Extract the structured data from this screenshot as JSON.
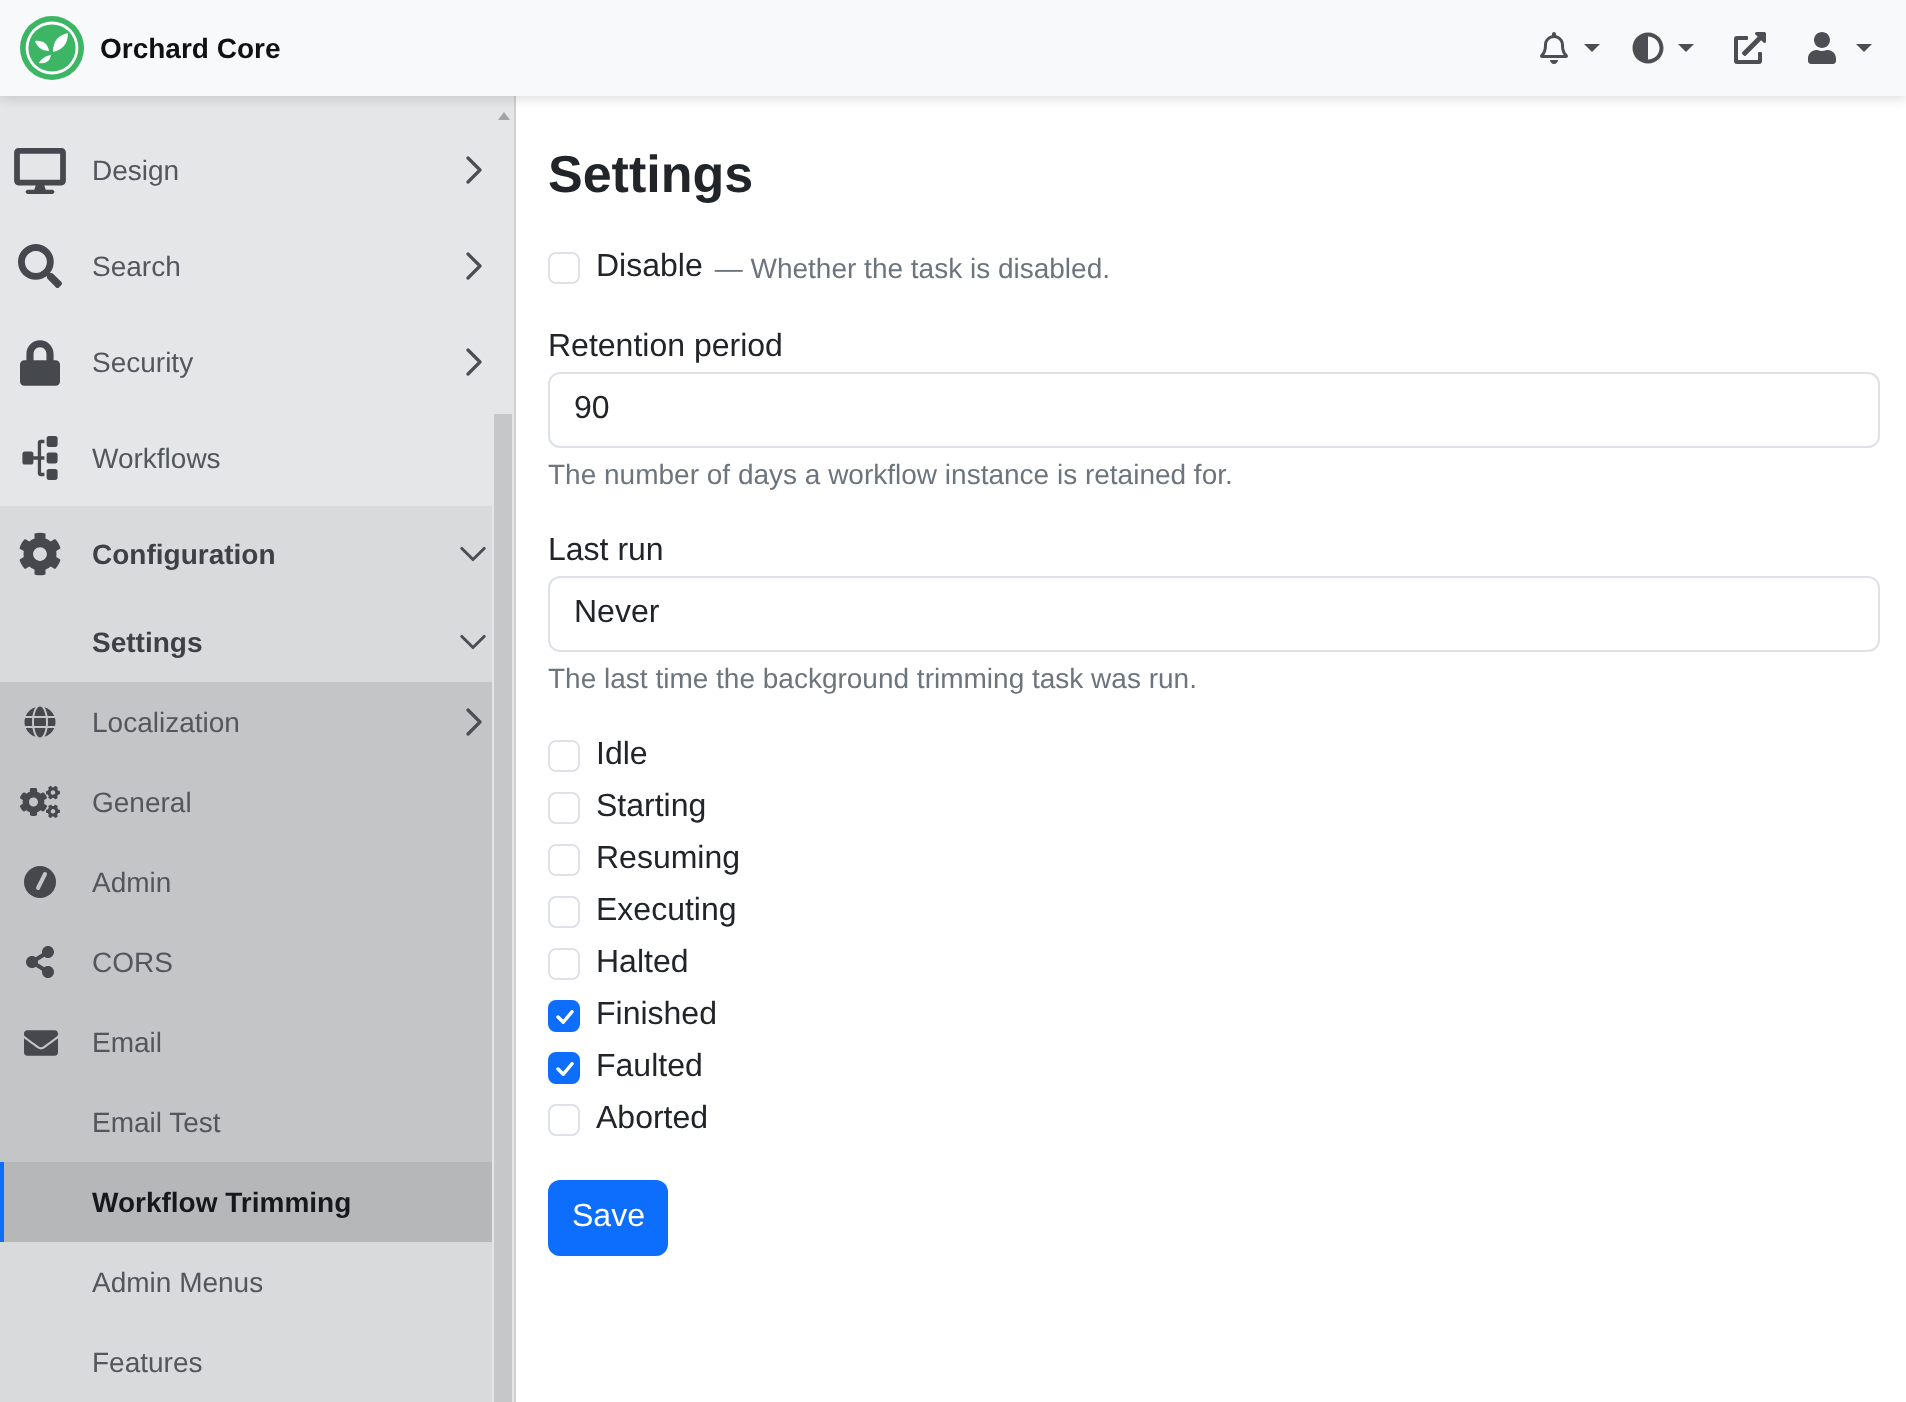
{
  "header": {
    "brand": "Orchard Core"
  },
  "sidebar": {
    "items": [
      {
        "label": "Design",
        "expanded": false,
        "selected": false
      },
      {
        "label": "Search",
        "expanded": false,
        "selected": false
      },
      {
        "label": "Security",
        "expanded": false,
        "selected": false
      },
      {
        "label": "Workflows",
        "selected": false
      },
      {
        "label": "Configuration",
        "expanded": true,
        "selected": false,
        "children": [
          {
            "label": "Settings",
            "expanded": true,
            "selected": false,
            "children": [
              {
                "label": "Localization",
                "expanded": false,
                "selected": false
              },
              {
                "label": "General",
                "selected": false
              },
              {
                "label": "Admin",
                "selected": false
              },
              {
                "label": "CORS",
                "selected": false
              },
              {
                "label": "Email",
                "selected": false
              },
              {
                "label": "Email Test",
                "selected": false
              },
              {
                "label": "Workflow Trimming",
                "selected": true
              }
            ]
          },
          {
            "label": "Admin Menus",
            "selected": false
          },
          {
            "label": "Features",
            "selected": false
          }
        ]
      }
    ]
  },
  "page": {
    "title": "Settings"
  },
  "form": {
    "disable": {
      "label": "Disable",
      "hint": "— Whether the task is disabled.",
      "checked": false
    },
    "fields": [
      {
        "label": "Retention period",
        "value": "90",
        "hint": "The number of days a workflow instance is retained for."
      },
      {
        "label": "Last run",
        "value": "Never",
        "hint": "The last time the background trimming task was run."
      }
    ],
    "statuses": [
      {
        "label": "Idle",
        "checked": false
      },
      {
        "label": "Starting",
        "checked": false
      },
      {
        "label": "Resuming",
        "checked": false
      },
      {
        "label": "Executing",
        "checked": false
      },
      {
        "label": "Halted",
        "checked": false
      },
      {
        "label": "Finished",
        "checked": true
      },
      {
        "label": "Faulted",
        "checked": true
      },
      {
        "label": "Aborted",
        "checked": false
      }
    ],
    "save_button": "Save"
  }
}
